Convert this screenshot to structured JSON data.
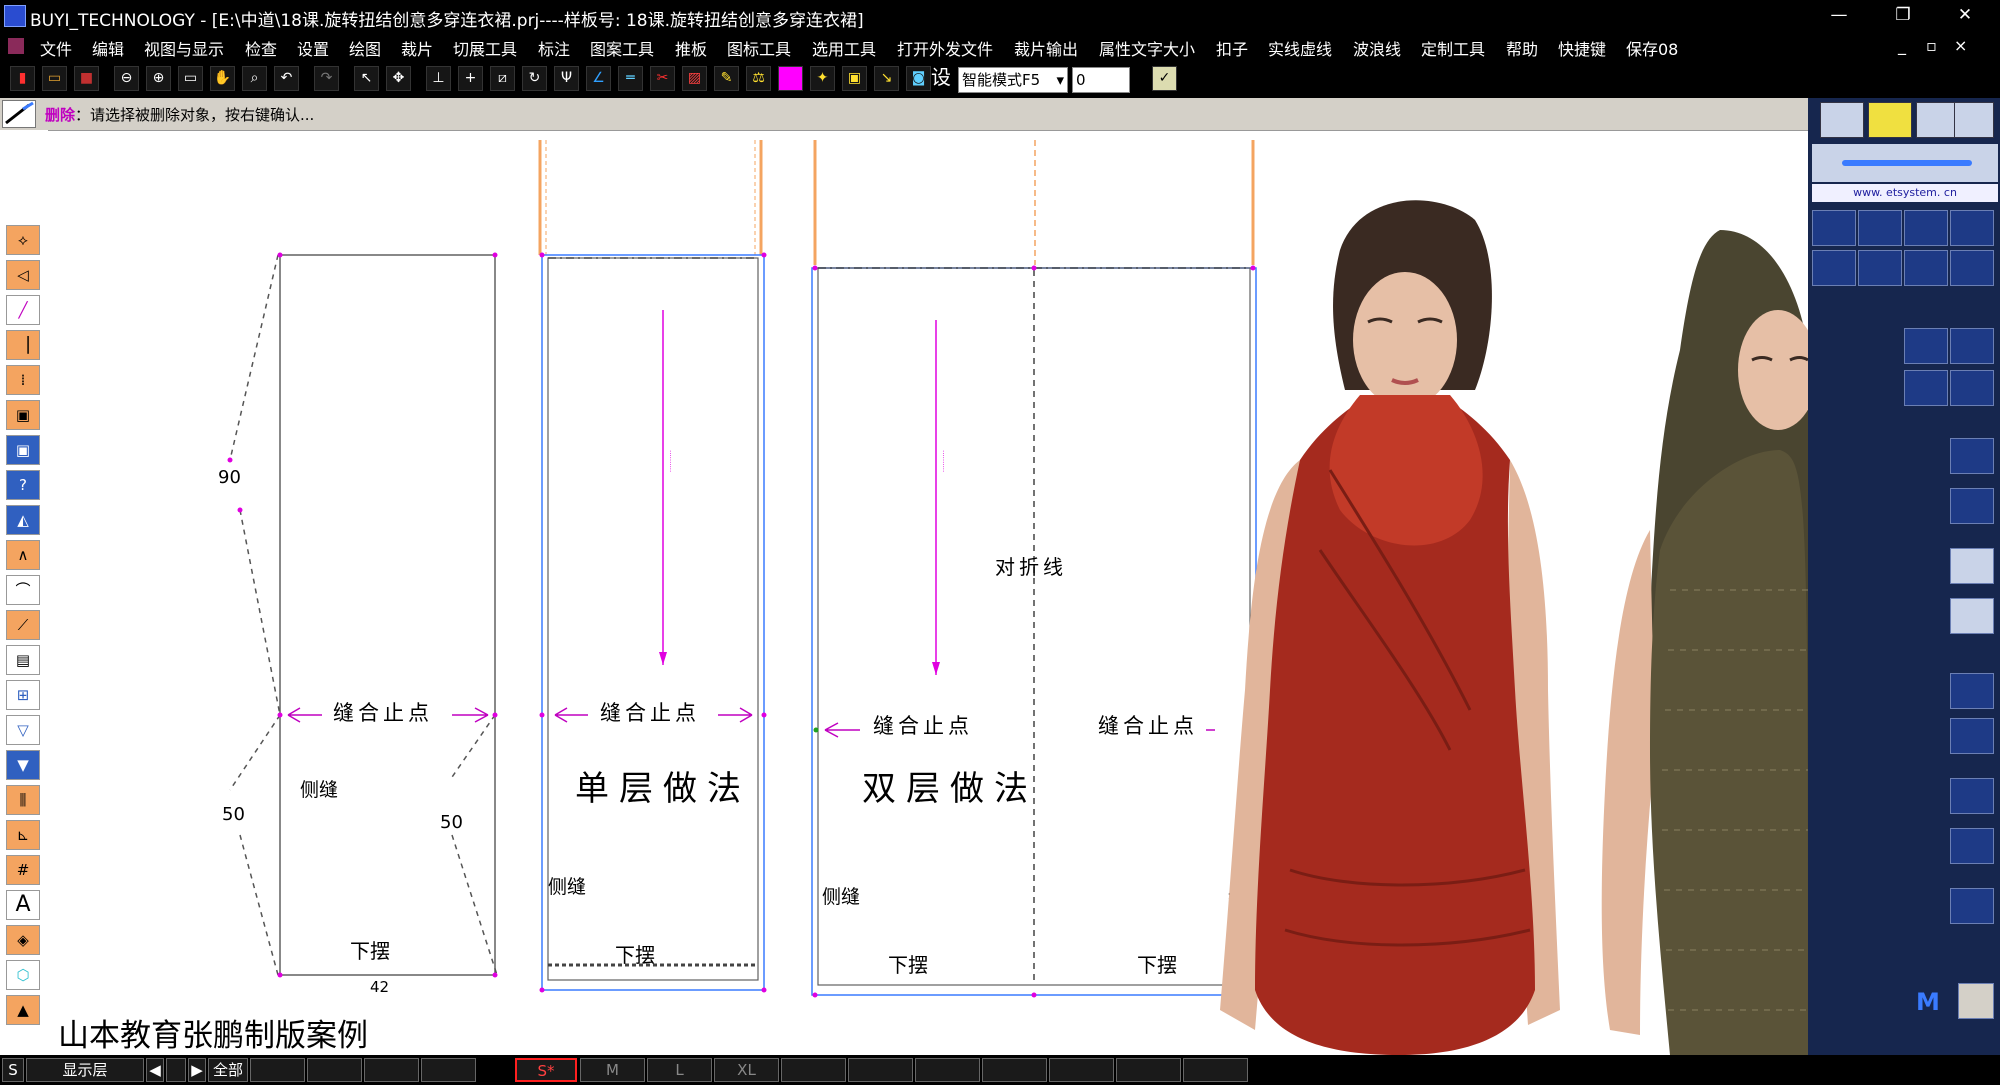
{
  "window": {
    "title": "BUYI_TECHNOLOGY - [E:\\中道\\18课.旋转扭结创意多穿连衣裙.prj----样板号: 18课.旋转扭结创意多穿连衣裙]",
    "min": "—",
    "restore": "❐",
    "close": "✕"
  },
  "menu": [
    "文件",
    "编辑",
    "视图与显示",
    "检查",
    "设置",
    "绘图",
    "裁片",
    "切展工具",
    "标注",
    "图案工具",
    "推板",
    "图标工具",
    "选用工具",
    "打开外发文件",
    "裁片输出",
    "属性文字大小",
    "扣子",
    "实线虚线",
    "波浪线",
    "定制工具",
    "帮助",
    "快捷键",
    "保存08"
  ],
  "toolbar": {
    "settings_glyph": "设",
    "mode": "智能模式F5",
    "number": "0"
  },
  "hint": {
    "command": "删除",
    "message": "：请选择被删除对象，按右键确认..."
  },
  "lefttool": {
    "text_tool": "A"
  },
  "rightpanel": {
    "url": "www. etsystem. cn",
    "m_label": "M"
  },
  "pattern": {
    "piece1": {
      "side_top": "90",
      "side_bottom_left": "50",
      "side_bottom_right": "50",
      "stop": "缝合止点",
      "seam": "侧缝",
      "hem": "下摆",
      "width": "42"
    },
    "piece2": {
      "stop": "缝合止点",
      "title": "单层做法",
      "seam": "侧缝",
      "hem": "下摆"
    },
    "piece3": {
      "fold": "对折线",
      "stop_left": "缝合止点",
      "stop_right": "缝合止点",
      "title": "双层做法",
      "seam": "侧缝",
      "seam_right": "缝",
      "hem_left": "下摆",
      "hem_right": "下摆"
    },
    "footer": "山本教育张鹏制版案例"
  },
  "status": {
    "s": "S",
    "layer": "显示层",
    "prev": "◀",
    "next": "▶",
    "all": "全部",
    "sizes": [
      "S*",
      "M",
      "L",
      "XL"
    ]
  },
  "colors": {
    "magenta": "#e000e0",
    "orange": "#f4a460",
    "blue_guide": "#3a7bff",
    "red_dress": "#a52a1e",
    "olive_dress": "#4a4530"
  }
}
